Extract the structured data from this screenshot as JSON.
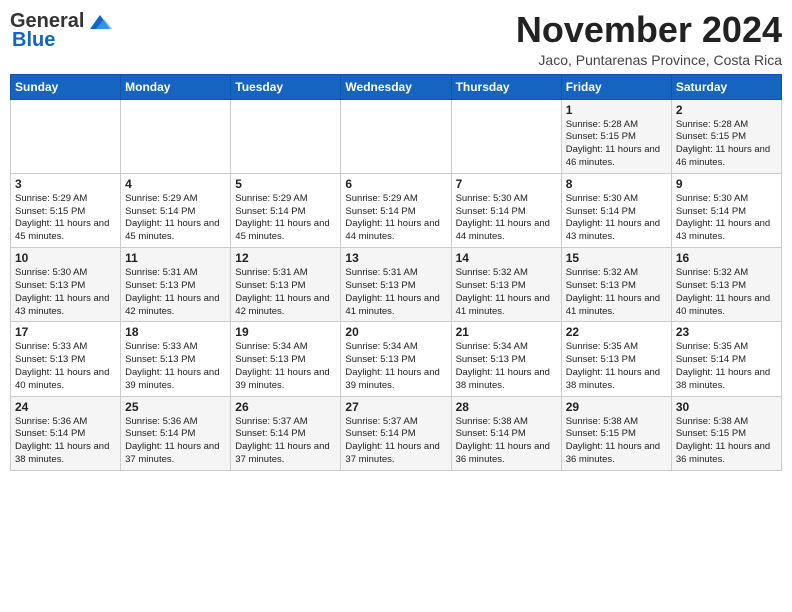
{
  "header": {
    "logo_general": "General",
    "logo_blue": "Blue",
    "month_title": "November 2024",
    "location": "Jaco, Puntarenas Province, Costa Rica"
  },
  "weekdays": [
    "Sunday",
    "Monday",
    "Tuesday",
    "Wednesday",
    "Thursday",
    "Friday",
    "Saturday"
  ],
  "weeks": [
    [
      {
        "day": "",
        "info": ""
      },
      {
        "day": "",
        "info": ""
      },
      {
        "day": "",
        "info": ""
      },
      {
        "day": "",
        "info": ""
      },
      {
        "day": "",
        "info": ""
      },
      {
        "day": "1",
        "info": "Sunrise: 5:28 AM\nSunset: 5:15 PM\nDaylight: 11 hours and 46 minutes."
      },
      {
        "day": "2",
        "info": "Sunrise: 5:28 AM\nSunset: 5:15 PM\nDaylight: 11 hours and 46 minutes."
      }
    ],
    [
      {
        "day": "3",
        "info": "Sunrise: 5:29 AM\nSunset: 5:15 PM\nDaylight: 11 hours and 45 minutes."
      },
      {
        "day": "4",
        "info": "Sunrise: 5:29 AM\nSunset: 5:14 PM\nDaylight: 11 hours and 45 minutes."
      },
      {
        "day": "5",
        "info": "Sunrise: 5:29 AM\nSunset: 5:14 PM\nDaylight: 11 hours and 45 minutes."
      },
      {
        "day": "6",
        "info": "Sunrise: 5:29 AM\nSunset: 5:14 PM\nDaylight: 11 hours and 44 minutes."
      },
      {
        "day": "7",
        "info": "Sunrise: 5:30 AM\nSunset: 5:14 PM\nDaylight: 11 hours and 44 minutes."
      },
      {
        "day": "8",
        "info": "Sunrise: 5:30 AM\nSunset: 5:14 PM\nDaylight: 11 hours and 43 minutes."
      },
      {
        "day": "9",
        "info": "Sunrise: 5:30 AM\nSunset: 5:14 PM\nDaylight: 11 hours and 43 minutes."
      }
    ],
    [
      {
        "day": "10",
        "info": "Sunrise: 5:30 AM\nSunset: 5:13 PM\nDaylight: 11 hours and 43 minutes."
      },
      {
        "day": "11",
        "info": "Sunrise: 5:31 AM\nSunset: 5:13 PM\nDaylight: 11 hours and 42 minutes."
      },
      {
        "day": "12",
        "info": "Sunrise: 5:31 AM\nSunset: 5:13 PM\nDaylight: 11 hours and 42 minutes."
      },
      {
        "day": "13",
        "info": "Sunrise: 5:31 AM\nSunset: 5:13 PM\nDaylight: 11 hours and 41 minutes."
      },
      {
        "day": "14",
        "info": "Sunrise: 5:32 AM\nSunset: 5:13 PM\nDaylight: 11 hours and 41 minutes."
      },
      {
        "day": "15",
        "info": "Sunrise: 5:32 AM\nSunset: 5:13 PM\nDaylight: 11 hours and 41 minutes."
      },
      {
        "day": "16",
        "info": "Sunrise: 5:32 AM\nSunset: 5:13 PM\nDaylight: 11 hours and 40 minutes."
      }
    ],
    [
      {
        "day": "17",
        "info": "Sunrise: 5:33 AM\nSunset: 5:13 PM\nDaylight: 11 hours and 40 minutes."
      },
      {
        "day": "18",
        "info": "Sunrise: 5:33 AM\nSunset: 5:13 PM\nDaylight: 11 hours and 39 minutes."
      },
      {
        "day": "19",
        "info": "Sunrise: 5:34 AM\nSunset: 5:13 PM\nDaylight: 11 hours and 39 minutes."
      },
      {
        "day": "20",
        "info": "Sunrise: 5:34 AM\nSunset: 5:13 PM\nDaylight: 11 hours and 39 minutes."
      },
      {
        "day": "21",
        "info": "Sunrise: 5:34 AM\nSunset: 5:13 PM\nDaylight: 11 hours and 38 minutes."
      },
      {
        "day": "22",
        "info": "Sunrise: 5:35 AM\nSunset: 5:13 PM\nDaylight: 11 hours and 38 minutes."
      },
      {
        "day": "23",
        "info": "Sunrise: 5:35 AM\nSunset: 5:14 PM\nDaylight: 11 hours and 38 minutes."
      }
    ],
    [
      {
        "day": "24",
        "info": "Sunrise: 5:36 AM\nSunset: 5:14 PM\nDaylight: 11 hours and 38 minutes."
      },
      {
        "day": "25",
        "info": "Sunrise: 5:36 AM\nSunset: 5:14 PM\nDaylight: 11 hours and 37 minutes."
      },
      {
        "day": "26",
        "info": "Sunrise: 5:37 AM\nSunset: 5:14 PM\nDaylight: 11 hours and 37 minutes."
      },
      {
        "day": "27",
        "info": "Sunrise: 5:37 AM\nSunset: 5:14 PM\nDaylight: 11 hours and 37 minutes."
      },
      {
        "day": "28",
        "info": "Sunrise: 5:38 AM\nSunset: 5:14 PM\nDaylight: 11 hours and 36 minutes."
      },
      {
        "day": "29",
        "info": "Sunrise: 5:38 AM\nSunset: 5:15 PM\nDaylight: 11 hours and 36 minutes."
      },
      {
        "day": "30",
        "info": "Sunrise: 5:38 AM\nSunset: 5:15 PM\nDaylight: 11 hours and 36 minutes."
      }
    ]
  ]
}
